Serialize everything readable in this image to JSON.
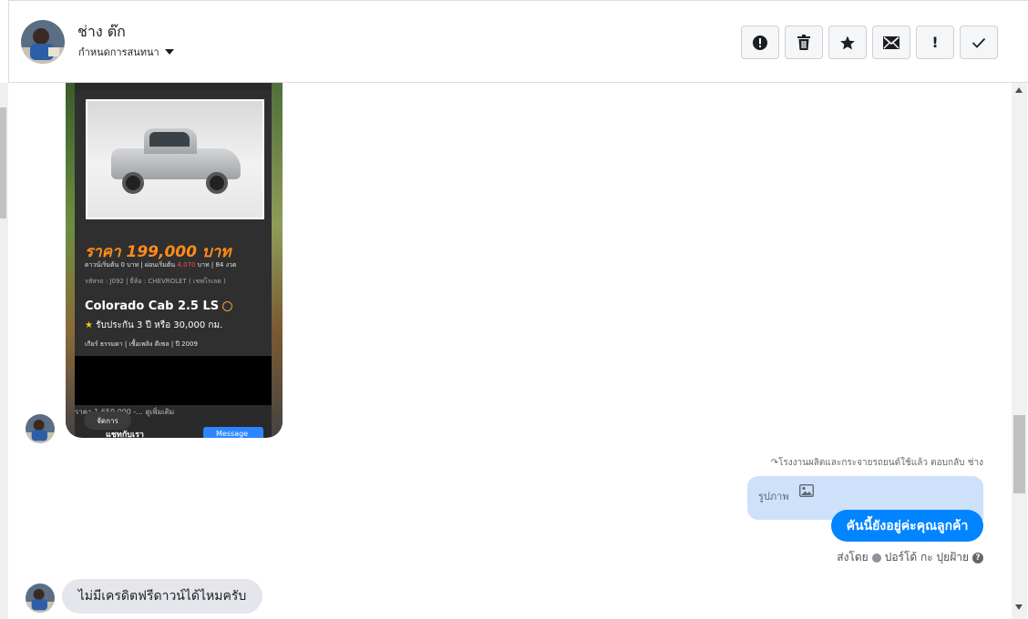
{
  "header": {
    "contact_name": "ช่าง ต๊ก",
    "assign_label": "กำหนดการสนทนา",
    "toolbar": {
      "spam_icon": "alert-circle-icon",
      "delete_icon": "trash-icon",
      "star_icon": "star-icon",
      "unread_icon": "envelope-icon",
      "important_label": "!",
      "done_icon": "checkmark-icon"
    }
  },
  "card": {
    "price": "ราคา 199,000 บาท",
    "down_payment_prefix": "ดาวน์เริ่มต้น 0 บาท | ผ่อนเริ่มต้น ",
    "installment": "4,070",
    "down_payment_suffix": " บาท | 84 งวด",
    "code_line": "รหัสรถ : J092 | ยี่ห้อ : CHEVROLET ( เชฟโรเลต )",
    "model": "Colorado Cab 2.5 LS",
    "warranty": "รับประกัน 3 ปี หรือ 30,000 กม.",
    "specs": "เกียร์ ธรรมดา  |  เชื้อเพลิง ดีเซล  |  ปี 2009",
    "footer_text": "ราคา 1,659,000 -... ดูเพิ่มเติม",
    "manage_label": "จัดการ",
    "footer_name": "แชทกับเรา",
    "message_button": "Message"
  },
  "outgoing": {
    "reply_note": "โรงงานผลิตและกระจายรถยนต์ใช้แล้ว ตอบกลับ ช่าง",
    "image_label": "รูปภาพ",
    "message": "คันนี้ยังอยู่ค่ะคุณลูกค้า",
    "sent_by_label": "ส่งโดย",
    "sender_name": "ปอร์โด้ กะ ปุยฝ้าย"
  },
  "incoming": {
    "message": "ไม่มีเครดิตฟรีดาวน์ได้ไหมครับ"
  },
  "colors": {
    "accent": "#0084ff",
    "incoming_bubble": "#e4e6eb",
    "image_reply_bg": "#cfe1fa",
    "price_orange": "#ff8c1a"
  }
}
